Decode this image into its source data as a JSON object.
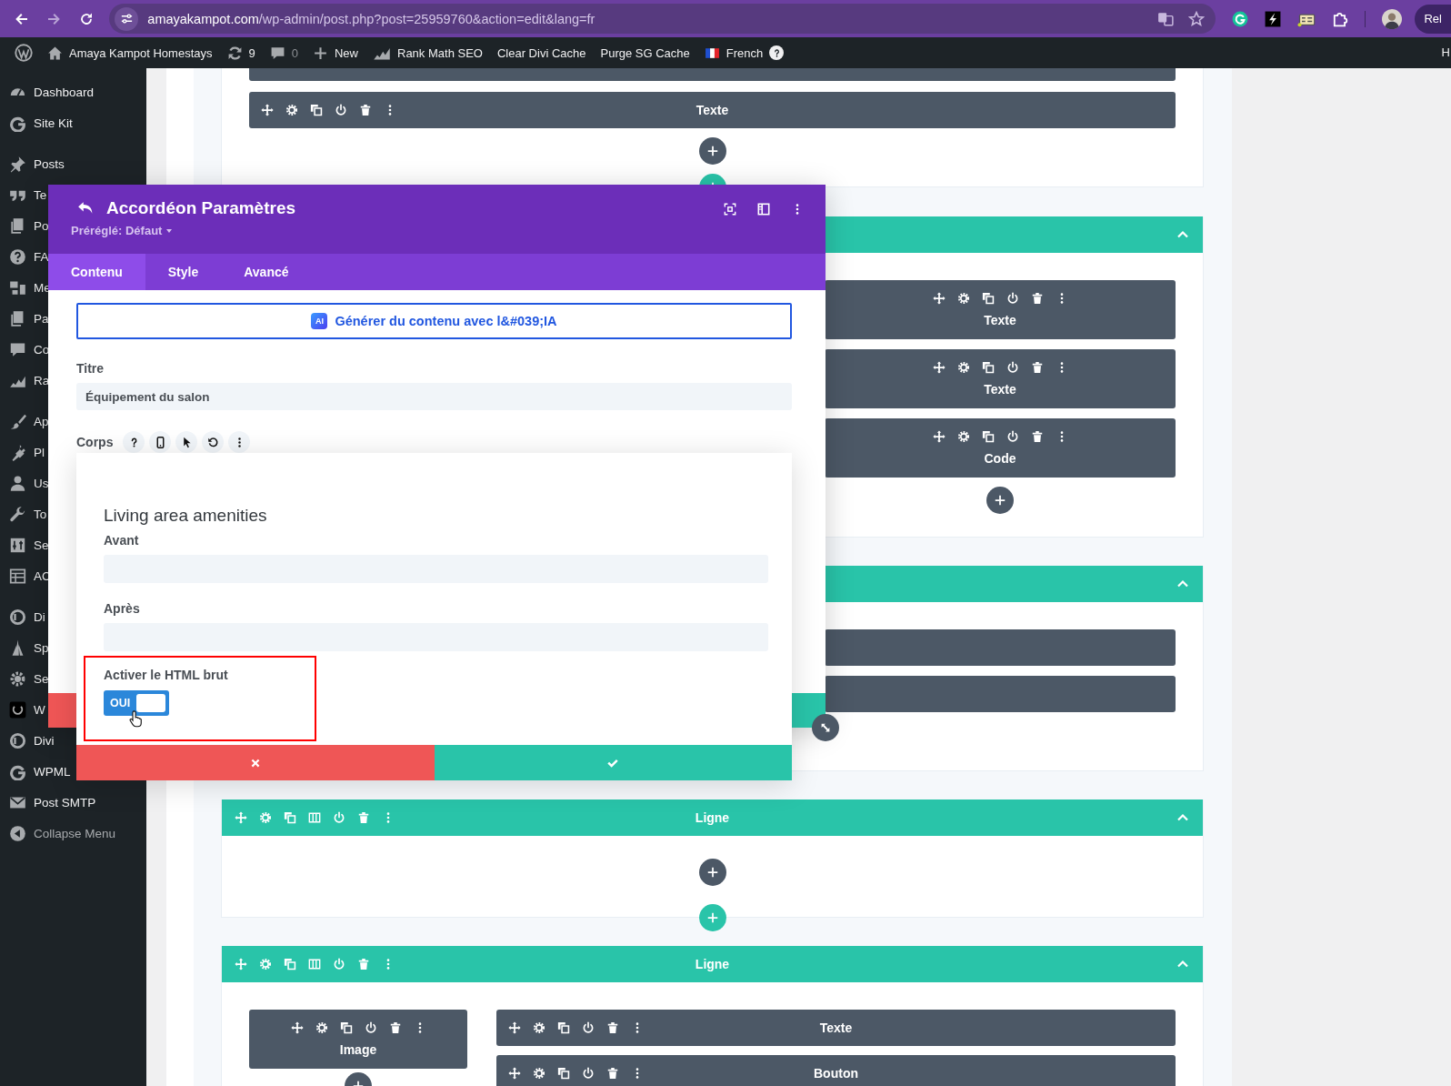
{
  "browser": {
    "url_host": "amayakampot.com",
    "url_path": "/wp-admin/post.php?post=25959760&action=edit&lang=fr",
    "profile_label": "Rel"
  },
  "admin_bar": {
    "items": [
      {
        "kind": "logo"
      },
      {
        "kind": "site",
        "label": "Amaya Kampot Homestays"
      },
      {
        "kind": "updates",
        "label": "9"
      },
      {
        "kind": "comments",
        "label": "0"
      },
      {
        "kind": "new",
        "label": "New"
      },
      {
        "kind": "seo",
        "label": "Rank Math SEO"
      },
      {
        "kind": "text",
        "label": "Clear Divi Cache"
      },
      {
        "kind": "text",
        "label": "Purge SG Cache"
      },
      {
        "kind": "language",
        "label": "French"
      }
    ],
    "edge_label": "H"
  },
  "sidebar": {
    "groups": [
      {
        "items": [
          {
            "label": "Dashboard"
          },
          {
            "label": "Site Kit"
          }
        ]
      },
      {
        "items": [
          {
            "label": "Posts"
          },
          {
            "label": "Te"
          },
          {
            "label": "Po"
          },
          {
            "label": "FA"
          },
          {
            "label": "Me"
          },
          {
            "label": "Pa"
          },
          {
            "label": "Co"
          },
          {
            "label": "Ra"
          }
        ]
      },
      {
        "items": [
          {
            "label": "Ap"
          },
          {
            "label": "Pl"
          },
          {
            "label": "Us"
          },
          {
            "label": "To"
          },
          {
            "label": "Se"
          },
          {
            "label": "AC"
          }
        ]
      },
      {
        "items": [
          {
            "label": "Di"
          },
          {
            "label": "Sp"
          },
          {
            "label": "Se"
          },
          {
            "label": "W"
          },
          {
            "label": "Divi"
          },
          {
            "label": "WPML"
          },
          {
            "label": "Post SMTP"
          }
        ]
      }
    ],
    "collapse_label": "Collapse Menu"
  },
  "canvas": {
    "section_1": {
      "modules": [
        {
          "label": "Texte"
        }
      ]
    },
    "section_2": {
      "modules": [
        {
          "label": "Texte"
        },
        {
          "label": "Texte"
        },
        {
          "label": "Code"
        }
      ]
    },
    "section_4": {
      "title": "Ligne"
    },
    "section_5": {
      "title": "Ligne",
      "left_modules": [
        {
          "label": "Image"
        }
      ],
      "right_modules": [
        {
          "label": "Texte"
        },
        {
          "label": "Bouton"
        }
      ]
    }
  },
  "modal": {
    "title": "Accordéon Paramètres",
    "preset": "Préréglé: Défaut",
    "tabs": [
      {
        "label": "Contenu",
        "selected": true
      },
      {
        "label": "Style",
        "selected": false
      },
      {
        "label": "Avancé",
        "selected": false
      }
    ],
    "ai_badge": "AI",
    "ai_button": "Générer du contenu avec l&#039;IA",
    "title_field": {
      "label": "Titre",
      "value": "Équipement du salon"
    },
    "body_label": "Corps",
    "popup": {
      "heading": "Living area amenities",
      "before": {
        "label": "Avant"
      },
      "after": {
        "label": "Après"
      },
      "raw_html": {
        "label": "Activer le HTML brut",
        "on": true,
        "text": "OUI"
      }
    }
  }
}
